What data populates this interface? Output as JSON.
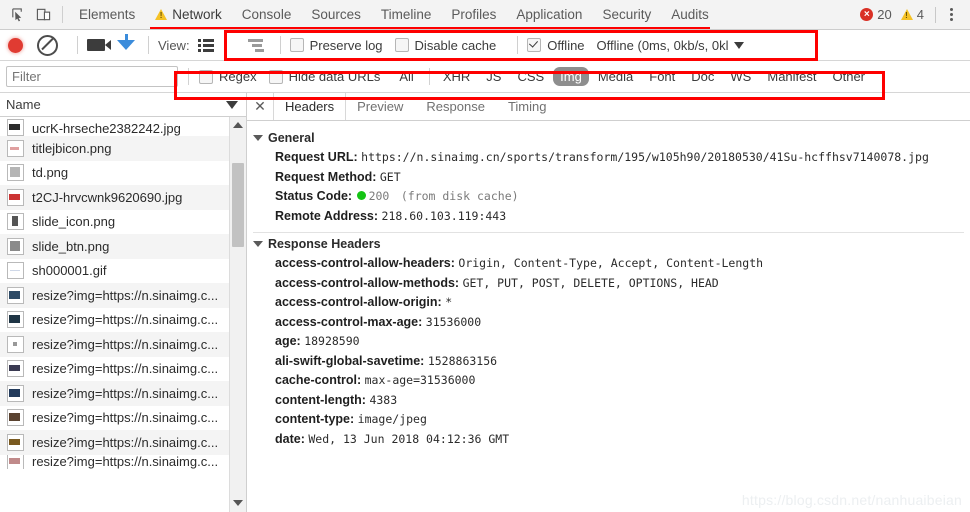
{
  "topbar": {
    "inspect_icon": "inspect-cursor-icon",
    "device_icon": "device-toolbar-icon",
    "tabs": [
      {
        "label": "Elements",
        "active": false,
        "warn": false
      },
      {
        "label": "Network",
        "active": true,
        "warn": true
      },
      {
        "label": "Console",
        "active": false,
        "warn": false
      },
      {
        "label": "Sources",
        "active": false,
        "warn": false
      },
      {
        "label": "Timeline",
        "active": false,
        "warn": false
      },
      {
        "label": "Profiles",
        "active": false,
        "warn": false
      },
      {
        "label": "Application",
        "active": false,
        "warn": false
      },
      {
        "label": "Security",
        "active": false,
        "warn": false
      },
      {
        "label": "Audits",
        "active": false,
        "warn": false
      }
    ],
    "error_count": "20",
    "warning_count": "4",
    "error_mark": "×",
    "menu_icon": "kebab-menu-icon"
  },
  "toolbar": {
    "record_icon": "record-button-icon",
    "clear_icon": "clear-button-icon",
    "capture_icon": "camera-screenshot-icon",
    "filter_icon": "funnel-filter-icon",
    "view_label": "View:",
    "view_list_icon": "list-view-icon",
    "view_waterfall_icon": "waterfall-view-icon",
    "preserve_log": {
      "label": "Preserve log",
      "checked": false
    },
    "disable_cache": {
      "label": "Disable cache",
      "checked": false
    },
    "offline": {
      "label": "Offline",
      "checked": true
    },
    "throttle_value": "Offline (0ms, 0kb/s, 0kl",
    "throttle_caret": "chevron-down-icon"
  },
  "filterbar": {
    "input_value": "",
    "input_placeholder": "Filter",
    "regex": {
      "label": "Regex",
      "checked": false
    },
    "hide_data_urls": {
      "label": "Hide data URLs",
      "checked": false
    },
    "types": [
      {
        "label": "All",
        "selected": false
      },
      {
        "label": "XHR",
        "selected": false
      },
      {
        "label": "JS",
        "selected": false
      },
      {
        "label": "CSS",
        "selected": false
      },
      {
        "label": "Img",
        "selected": true
      },
      {
        "label": "Media",
        "selected": false
      },
      {
        "label": "Font",
        "selected": false
      },
      {
        "label": "Doc",
        "selected": false
      },
      {
        "label": "WS",
        "selected": false
      },
      {
        "label": "Manifest",
        "selected": false
      },
      {
        "label": "Other",
        "selected": false
      }
    ]
  },
  "requests_panel": {
    "column_header": "Name",
    "sort_icon": "sort-descending-arrow",
    "scrollbar_up_icon": "scroll-up-arrow",
    "scrollbar_down_icon": "scroll-down-arrow",
    "rows": [
      {
        "name": "ucrK-hrseche2382242.jpg"
      },
      {
        "name": "titlejbicon.png"
      },
      {
        "name": "td.png"
      },
      {
        "name": "t2CJ-hrvcwnk9620690.jpg"
      },
      {
        "name": "slide_icon.png"
      },
      {
        "name": "slide_btn.png"
      },
      {
        "name": "sh000001.gif"
      },
      {
        "name": "resize?img=https://n.sinaimg.c..."
      },
      {
        "name": "resize?img=https://n.sinaimg.c..."
      },
      {
        "name": "resize?img=https://n.sinaimg.c..."
      },
      {
        "name": "resize?img=https://n.sinaimg.c..."
      },
      {
        "name": "resize?img=https://n.sinaimg.c..."
      },
      {
        "name": "resize?img=https://n.sinaimg.c..."
      },
      {
        "name": "resize?img=https://n.sinaimg.c..."
      },
      {
        "name": "resize?img=https://n.sinaimg.c..."
      },
      {
        "name": "resize?img=https://n.sinaimg.c..."
      }
    ]
  },
  "details": {
    "close_icon": "close-icon",
    "tabs": [
      {
        "label": "Headers",
        "active": true
      },
      {
        "label": "Preview",
        "active": false
      },
      {
        "label": "Response",
        "active": false
      },
      {
        "label": "Timing",
        "active": false
      }
    ],
    "general": {
      "title": "General",
      "request_url_key": "Request URL:",
      "request_url_value": "https://n.sinaimg.cn/sports/transform/195/w105h90/20180530/41Su-hcffhsv7140078.jpg",
      "request_method_key": "Request Method:",
      "request_method_value": "GET",
      "status_code_key": "Status Code:",
      "status_code_value": "200",
      "status_code_note": "(from disk cache)",
      "status_dot_icon": "status-ok-dot",
      "remote_address_key": "Remote Address:",
      "remote_address_value": "218.60.103.119:443"
    },
    "response_headers": {
      "title": "Response Headers",
      "items": [
        {
          "key": "access-control-allow-headers:",
          "value": "Origin, Content-Type, Accept, Content-Length"
        },
        {
          "key": "access-control-allow-methods:",
          "value": "GET, PUT, POST, DELETE, OPTIONS, HEAD"
        },
        {
          "key": "access-control-allow-origin:",
          "value": "*"
        },
        {
          "key": "access-control-max-age:",
          "value": "31536000"
        },
        {
          "key": "age:",
          "value": "18928590"
        },
        {
          "key": "ali-swift-global-savetime:",
          "value": "1528863156"
        },
        {
          "key": "cache-control:",
          "value": "max-age=31536000"
        },
        {
          "key": "content-length:",
          "value": "4383"
        },
        {
          "key": "content-type:",
          "value": "image/jpeg"
        },
        {
          "key": "date:",
          "value": "Wed, 13 Jun 2018 04:12:36 GMT"
        }
      ]
    }
  },
  "watermark": "https://blog.csdn.net/nanhuaibeian",
  "colors": {
    "highlight": "#fe0000",
    "accent": "#3b8cdb",
    "error": "#d93025",
    "warning": "#f5c225",
    "status_ok": "#15c415",
    "selected_chip": "#8e8e8e"
  }
}
